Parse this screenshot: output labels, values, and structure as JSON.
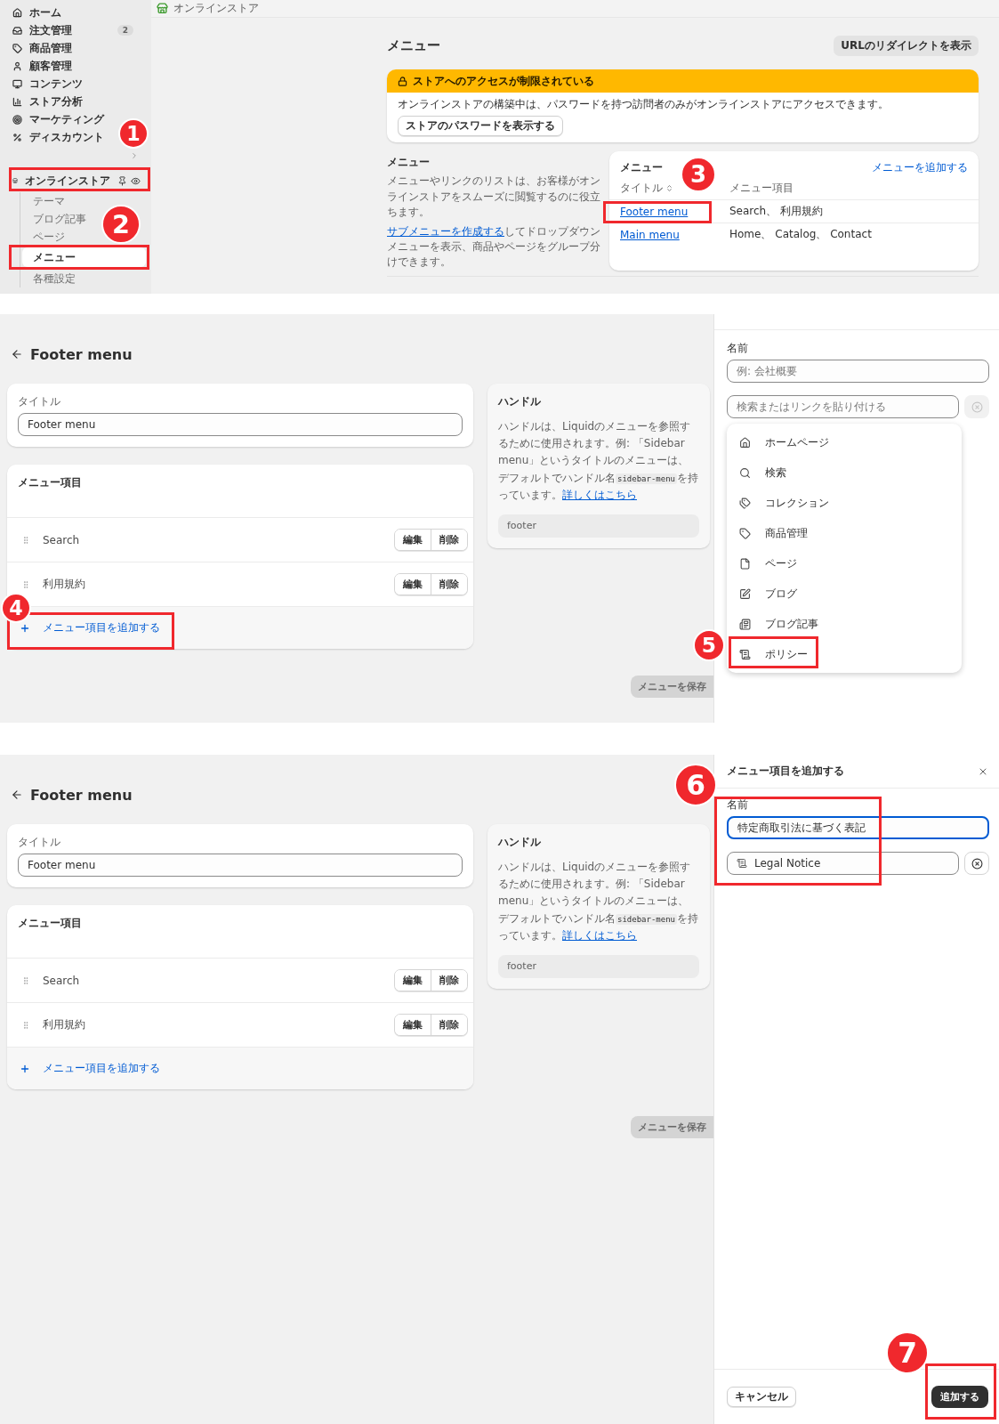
{
  "menu_list_screen": {
    "sidebar": {
      "items": [
        {
          "label": "ホーム"
        },
        {
          "label": "注文管理",
          "badge": "2"
        },
        {
          "label": "商品管理"
        },
        {
          "label": "顧客管理"
        },
        {
          "label": "コンテンツ"
        },
        {
          "label": "ストア分析"
        },
        {
          "label": "マーケティング"
        },
        {
          "label": "ディスカウント"
        }
      ],
      "channel": {
        "label": "オンラインストア"
      },
      "sub_items": [
        {
          "label": "テーマ",
          "selected": false
        },
        {
          "label": "ブログ記事",
          "selected": false
        },
        {
          "label": "ページ",
          "selected": false
        },
        {
          "label": "メニュー",
          "selected": true
        },
        {
          "label": "各種設定",
          "selected": false
        }
      ]
    },
    "breadcrumb": "オンラインストア",
    "page_title": "メニュー",
    "redirect_button": "URLのリダイレクトを表示",
    "banner": {
      "title": "ストアへのアクセスが制限されている",
      "text": "オンラインストアの構築中は、パスワードを持つ訪問者のみがオンラインストアにアクセスできます。",
      "button": "ストアのパスワードを表示する"
    },
    "about": {
      "heading": "メニュー",
      "text": "メニューやリンクのリストは、お客様がオンラインストアをスムーズに閲覧するのに役立ちます。",
      "link": "サブメニューを作成する",
      "text_after": "してドロップダウンメニューを表示、商品やページをグループ分けできます。"
    },
    "menus_card": {
      "title": "メニュー",
      "add_link": "メニューを追加する",
      "columns": [
        "タイトル",
        "メニュー項目"
      ],
      "rows": [
        {
          "title": "Footer menu",
          "items": "Search、 利用規約"
        },
        {
          "title": "Main menu",
          "items": "Home、 Catalog、 Contact"
        }
      ]
    },
    "markers": [
      {
        "number": "1"
      },
      {
        "number": "2"
      },
      {
        "number": "3"
      }
    ]
  },
  "item_picker_screen": {
    "page_title": "Footer menu",
    "title_card": {
      "label": "タイトル",
      "value": "Footer menu"
    },
    "items_card": {
      "heading": "メニュー項目",
      "rows": [
        {
          "label": "Search",
          "edit": "編集",
          "delete": "削除"
        },
        {
          "label": "利用規約",
          "edit": "編集",
          "delete": "削除"
        }
      ],
      "add_link": "メニュー項目を追加する"
    },
    "handle_card": {
      "heading": "ハンドル",
      "text": "ハンドルは、Liquidのメニューを参照するために使用されます。例: 「Sidebar menu」というタイトルのメニューは、デフォルトでハンドル名",
      "code": "sidebar-menu",
      "text_after": "を持っています。",
      "link": "詳しくはこちら",
      "value": "footer"
    },
    "save_button": {
      "label": "メニューを保存",
      "disabled": true
    },
    "drawer": {
      "name_label": "名前",
      "name_field": {
        "placeholder": "例: 会社概要",
        "focused": false
      },
      "link_field": {
        "placeholder": "検索またはリンクを貼り付ける"
      },
      "clear_disabled": true,
      "options": [
        {
          "label": "ホームページ",
          "selected": false
        },
        {
          "label": "検索",
          "selected": false
        },
        {
          "label": "コレクション",
          "selected": false
        },
        {
          "label": "商品管理",
          "selected": false
        },
        {
          "label": "ページ",
          "selected": false
        },
        {
          "label": "ブログ",
          "selected": false
        },
        {
          "label": "ブログ記事",
          "selected": false
        },
        {
          "label": "ポリシー",
          "selected": false
        }
      ]
    },
    "markers": [
      {
        "number": "4"
      },
      {
        "number": "5"
      }
    ]
  },
  "item_filled_screen": {
    "page_title": "Footer menu",
    "title_card": {
      "label": "タイトル",
      "value": "Footer menu"
    },
    "items_card": {
      "heading": "メニュー項目",
      "rows": [
        {
          "label": "Search",
          "edit": "編集",
          "delete": "削除"
        },
        {
          "label": "利用規約",
          "edit": "編集",
          "delete": "削除"
        }
      ],
      "add_link": "メニュー項目を追加する"
    },
    "handle_card": {
      "heading": "ハンドル",
      "text": "ハンドルは、Liquidのメニューを参照するために使用されます。例: 「Sidebar menu」というタイトルのメニューは、デフォルトでハンドル名",
      "code": "sidebar-menu",
      "text_after": "を持っています。",
      "link": "詳しくはこちら",
      "value": "footer"
    },
    "save_button": {
      "label": "メニューを保存",
      "disabled": true
    },
    "drawer": {
      "title": "メニュー項目を追加する",
      "name_label": "名前",
      "name_field": {
        "value": "特定商取引法に基づく表記",
        "focused": true
      },
      "link_field": {
        "value": "Legal Notice"
      },
      "clear_disabled": false,
      "cancel_button": "キャンセル",
      "add_button": "追加する"
    },
    "markers": [
      {
        "number": "6"
      },
      {
        "number": "7"
      }
    ]
  }
}
